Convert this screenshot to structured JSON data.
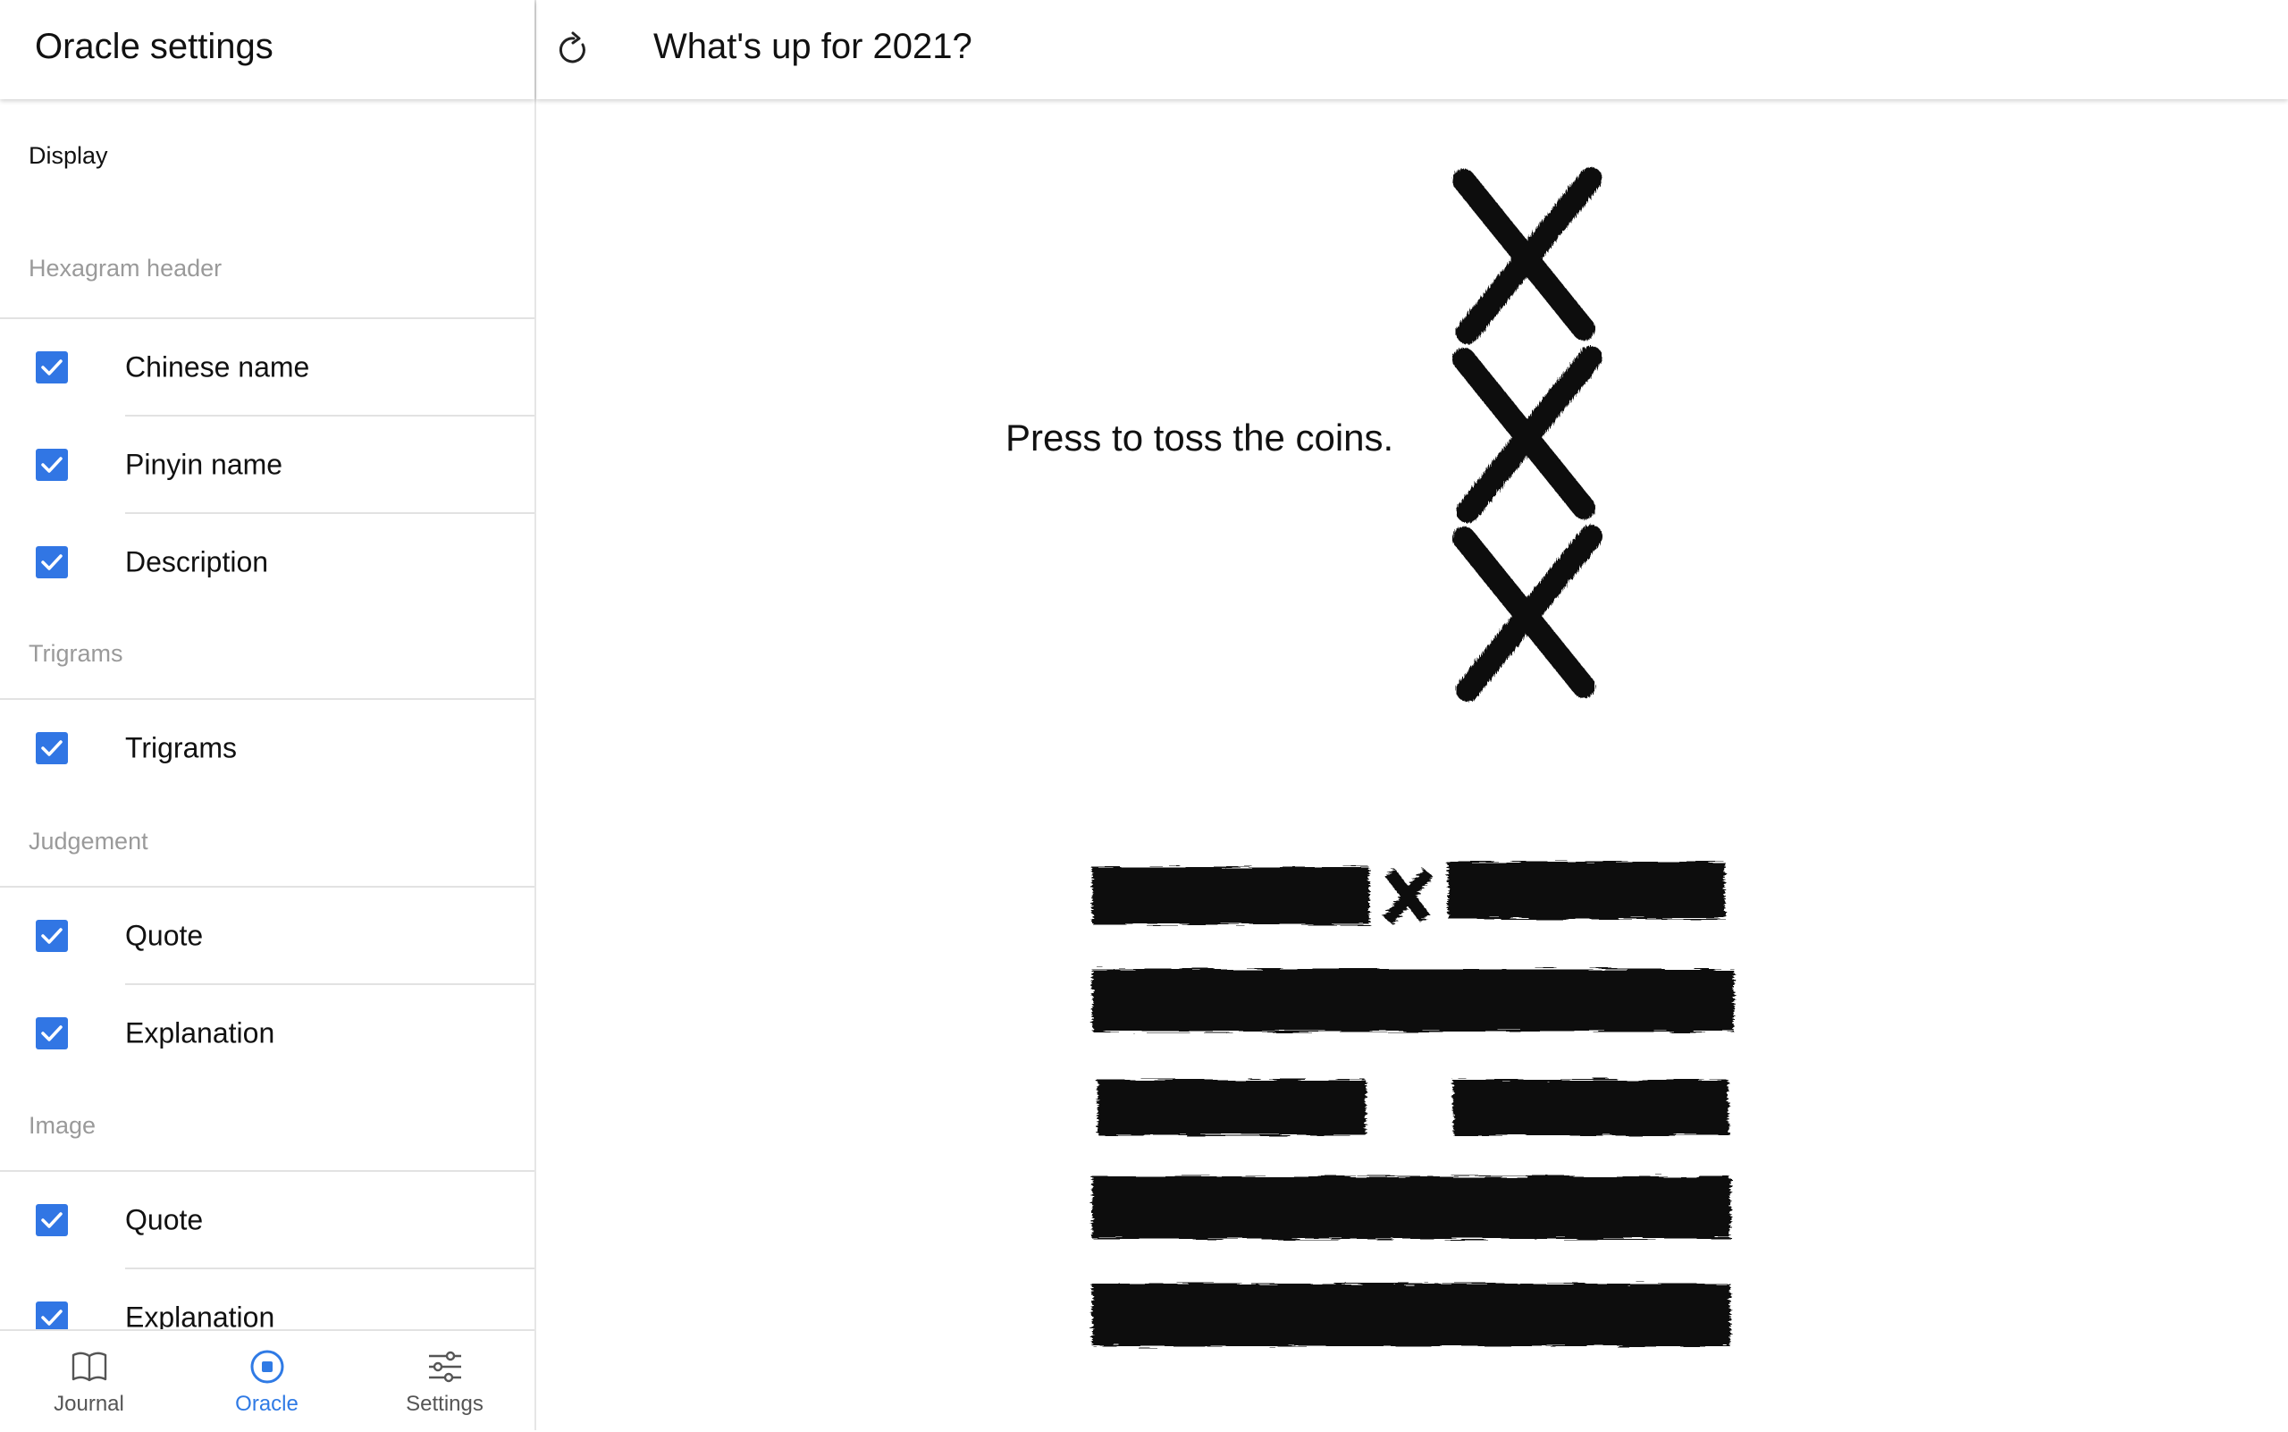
{
  "sidebar": {
    "title": "Oracle settings",
    "display_label": "Display",
    "sections": [
      {
        "header": "Hexagram header",
        "items": [
          {
            "label": "Chinese name",
            "checked": true
          },
          {
            "label": "Pinyin name",
            "checked": true
          },
          {
            "label": "Description",
            "checked": true
          }
        ]
      },
      {
        "header": "Trigrams",
        "items": [
          {
            "label": "Trigrams",
            "checked": true
          }
        ]
      },
      {
        "header": "Judgement",
        "items": [
          {
            "label": "Quote",
            "checked": true
          },
          {
            "label": "Explanation",
            "checked": true
          }
        ]
      },
      {
        "header": "Image",
        "items": [
          {
            "label": "Quote",
            "checked": true
          },
          {
            "label": "Explanation",
            "checked": true
          }
        ]
      }
    ]
  },
  "bottom_nav": {
    "items": [
      {
        "label": "Journal",
        "icon": "book-icon",
        "active": false
      },
      {
        "label": "Oracle",
        "icon": "oracle-circle-icon",
        "active": true
      },
      {
        "label": "Settings",
        "icon": "sliders-icon",
        "active": false
      }
    ]
  },
  "main": {
    "title": "What's up for 2021?",
    "refresh_icon": "refresh-icon",
    "prompt": "Press to toss the coins.",
    "coins": [
      "x",
      "x",
      "x"
    ],
    "hexagram_lines_top_to_bottom": [
      "broken-changing",
      "solid",
      "broken",
      "solid",
      "solid"
    ]
  },
  "colors": {
    "accent": "#3176e4",
    "nav_active": "#2f7ae5",
    "subheader": "#9a9a9a",
    "ink": "#111111"
  }
}
